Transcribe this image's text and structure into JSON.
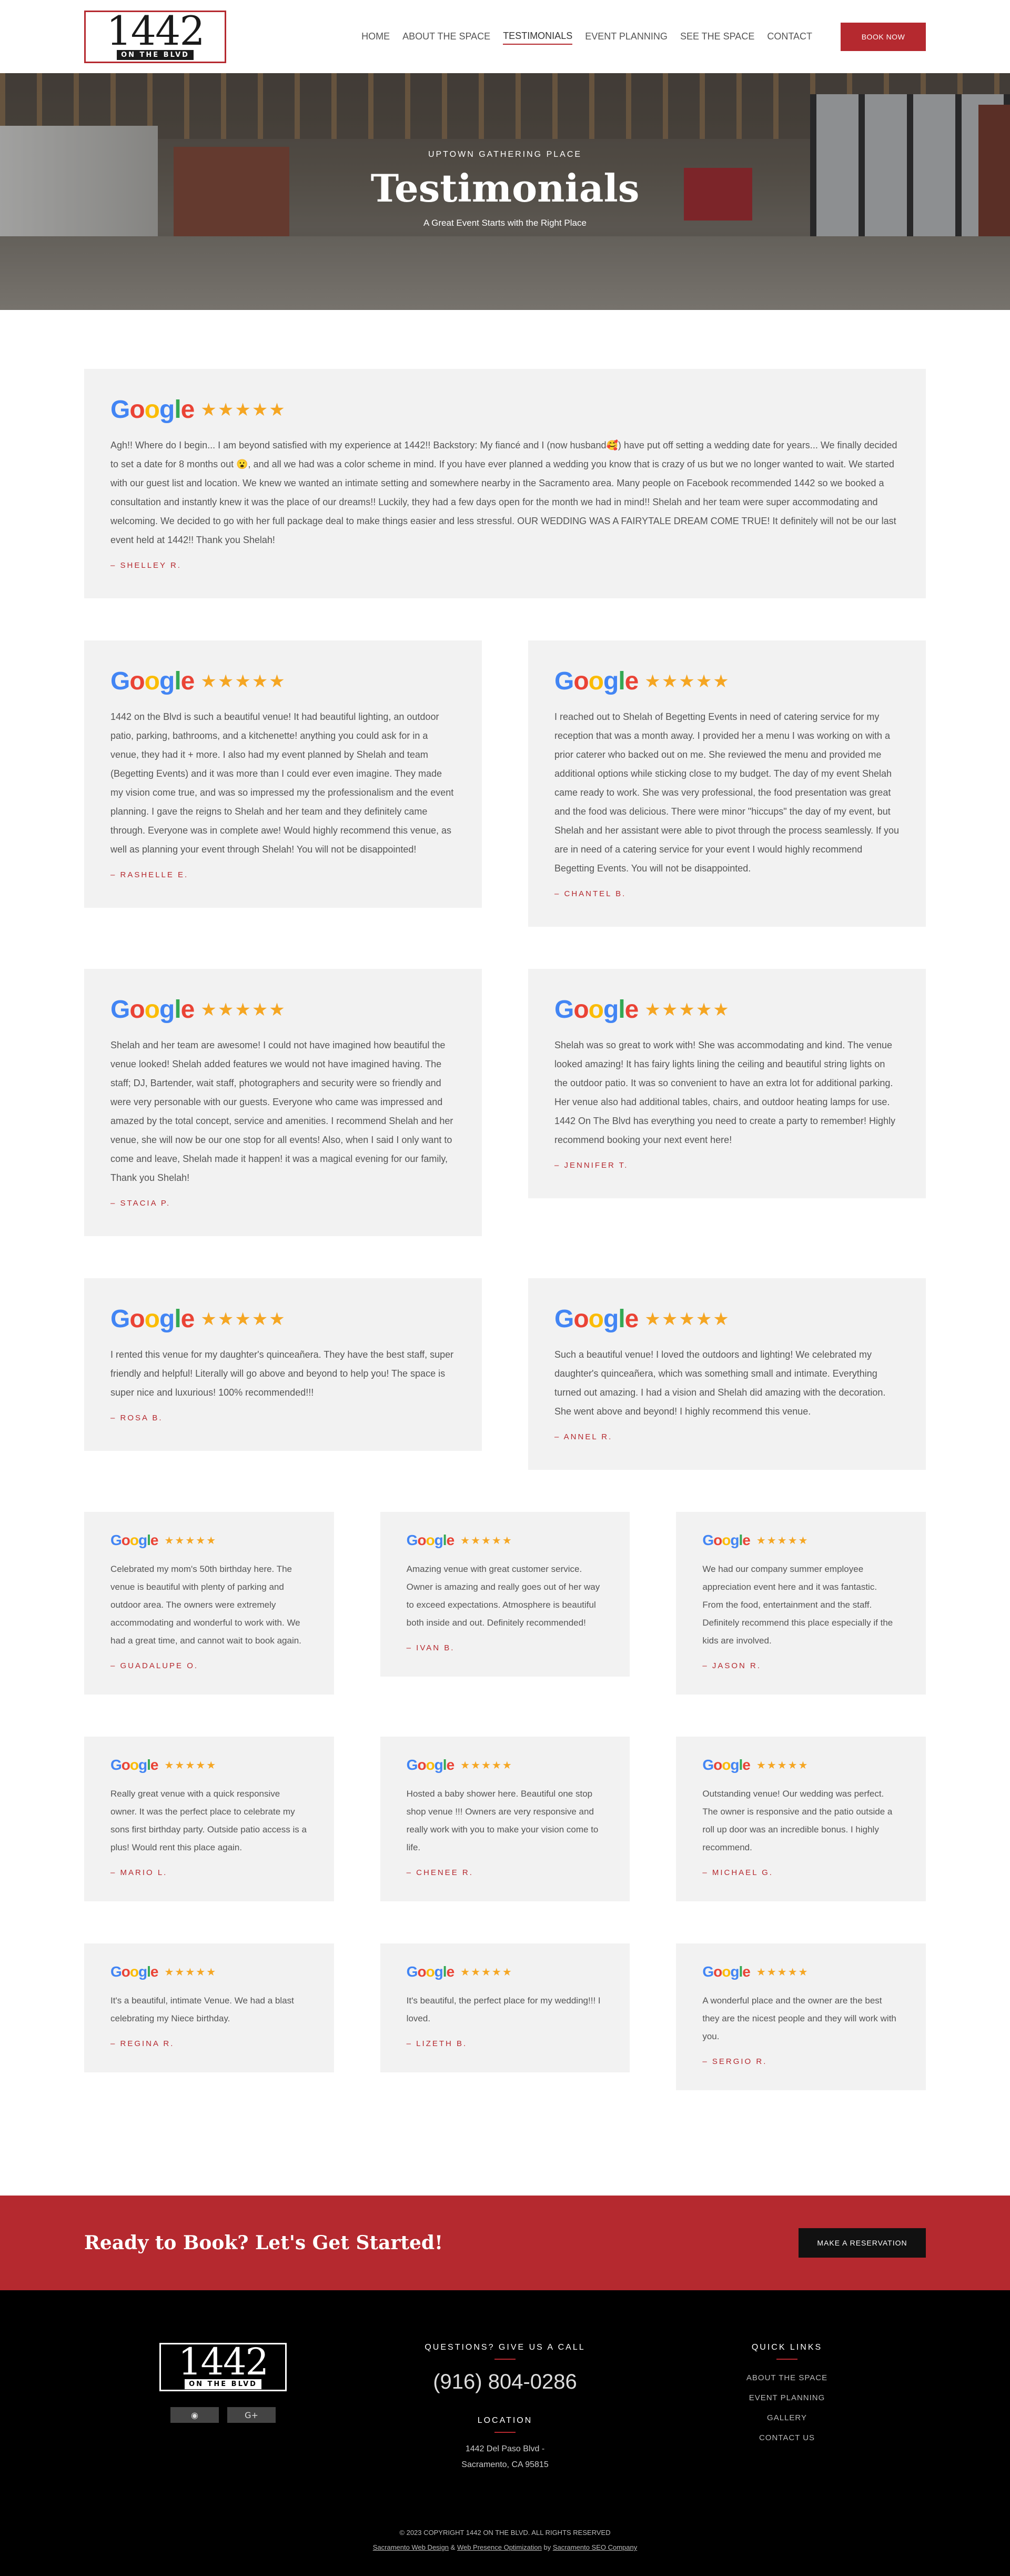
{
  "header": {
    "logo_number": "1442",
    "logo_sub": "ON THE BLVD",
    "nav": [
      {
        "label": "HOME",
        "active": false
      },
      {
        "label": "ABOUT THE SPACE",
        "active": false
      },
      {
        "label": "TESTIMONIALS",
        "active": true
      },
      {
        "label": "EVENT PLANNING",
        "active": false
      },
      {
        "label": "SEE THE SPACE",
        "active": false
      },
      {
        "label": "CONTACT",
        "active": false
      }
    ],
    "book_label": "BOOK NOW"
  },
  "hero": {
    "kicker": "UPTOWN GATHERING PLACE",
    "title": "Testimonials",
    "subtitle": "A Great Event Starts with the Right Place"
  },
  "google": {
    "word": "Google",
    "stars": "★★★★★"
  },
  "testimonials": [
    {
      "text": "Agh!! Where do I begin... I am beyond satisfied with my experience at 1442!! Backstory: My fiancé and I (now husband🥰) have put off setting a wedding date for years... We finally decided to set a date for 8 months out 😮, and all we had was a color scheme in mind. If you have ever planned a wedding you know that is crazy of us but we no longer wanted to wait. We started with our guest list and location. We knew we wanted an intimate setting and somewhere nearby in the Sacramento area. Many people on Facebook recommended 1442 so we booked a consultation and instantly knew it was the place of our dreams!! Luckily, they had a few days open for the month we had in mind!! Shelah and her team were super accommodating and welcoming. We decided to go with her full package deal to make things easier and less stressful. OUR WEDDING WAS A FAIRYTALE DREAM COME TRUE! It definitely will not be our last event held at 1442!! Thank you Shelah!",
      "author": "– SHELLEY R."
    },
    {
      "text": "1442 on the Blvd is such a beautiful venue! It had beautiful lighting, an outdoor patio, parking, bathrooms, and a kitchenette! anything you could ask for in a venue, they had it + more. I also had my event planned by Shelah and team (Begetting Events) and it was more than I could ever even imagine. They made my vision come true, and was so impressed my the professionalism and the event planning. I gave the reigns to Shelah and her team and they definitely came through. Everyone was in complete awe! Would highly recommend this venue, as well as planning your event through Shelah! You will not be disappointed!",
      "author": "– RASHELLE E."
    },
    {
      "text": "I reached out to Shelah of Begetting Events in need of catering service for my reception that was a month away. I provided her a menu I was working on with a prior caterer who backed out on me. She reviewed the menu and provided me additional options while sticking close to my budget. The day of my event Shelah came ready to work. She was very professional, the food presentation was great and the food was delicious. There were minor \"hiccups\" the day of my event, but Shelah and her assistant were able to pivot through the process seamlessly. If you are in need of a catering service for your event I would highly recommend Begetting Events. You will not be disappointed.",
      "author": "– CHANTEL B."
    },
    {
      "text": "Shelah and her team are awesome! I could not have imagined how beautiful the venue looked! Shelah added features we would not have imagined having. The staff; DJ, Bartender, wait staff, photographers and security were so friendly and were very personable with our guests. Everyone who came was impressed and amazed by the total concept, service and amenities. I recommend Shelah and her venue, she will now be our one stop for all events! Also, when I said I only want to come and leave, Shelah made it happen! it was a magical evening for our family, Thank you Shelah!",
      "author": "– STACIA P."
    },
    {
      "text": "Shelah was so great to work with! She was accommodating and kind. The venue looked amazing! It has fairy lights lining the ceiling and beautiful string lights on the outdoor patio. It was so convenient to have an extra lot for additional parking. Her venue also had additional tables, chairs, and outdoor heating lamps for use. 1442 On The Blvd has everything you need to create a party to remember! Highly recommend booking your next event here!",
      "author": "– JENNIFER T."
    },
    {
      "text": "I rented this venue for my daughter's quinceañera. They have the best staff, super friendly and helpful! Literally will go above and beyond to help you! The space is super nice and luxurious! 100% recommended!!!",
      "author": "– ROSA B."
    },
    {
      "text": "Such a beautiful venue! I loved the outdoors and lighting! We celebrated my daughter's quinceañera, which was something small and intimate. Everything turned out amazing. I had a vision and Shelah did amazing with the decoration. She went above and beyond! I highly recommend this venue.",
      "author": "– ANNEL R."
    },
    {
      "text": "Celebrated my mom's 50th birthday here. The venue is beautiful with plenty of parking and outdoor area. The owners were extremely accommodating and wonderful to work with. We had a great time, and cannot wait to book again.",
      "author": "– GUADALUPE O."
    },
    {
      "text": "Amazing venue with great customer service. Owner is amazing and really goes out of her way to exceed expectations. Atmosphere is beautiful both inside and out. Definitely recommended!",
      "author": "– IVAN B."
    },
    {
      "text": "We had our company summer employee appreciation event here and it was fantastic. From the food, entertainment and the staff. Definitely recommend this place especially if the kids are involved.",
      "author": "– JASON R."
    },
    {
      "text": "Really great venue with a quick responsive owner. It was the perfect place to celebrate my sons first birthday party. Outside patio access is a plus! Would rent this place again.",
      "author": "– MARIO L."
    },
    {
      "text": "Hosted a baby shower here. Beautiful one stop shop venue !!! Owners are very responsive and really work with you to make your vision come to life.",
      "author": "– CHENEE R."
    },
    {
      "text": "Outstanding venue! Our wedding was perfect. The owner is responsive and the patio outside a roll up door was an incredible bonus. I highly recommend.",
      "author": "– MICHAEL G."
    },
    {
      "text": "It's a beautiful, intimate Venue. We had a blast celebrating my Niece birthday.",
      "author": "– REGINA R."
    },
    {
      "text": "It's beautiful, the perfect place for my wedding!!! I loved.",
      "author": "– LIZETH B."
    },
    {
      "text": "A wonderful place and the owner are the best they are the nicest people and they will work with you.",
      "author": "– SERGIO R."
    }
  ],
  "cta": {
    "title_plain": "Ready to Book?",
    "title_bold": "Let's Get Started!",
    "button": "MAKE A RESERVATION"
  },
  "footer": {
    "logo_number": "1442",
    "logo_sub": "ON THE BLVD",
    "social": [
      "◉",
      "G+"
    ],
    "call_heading": "QUESTIONS? GIVE US A CALL",
    "phone": "(916) 804-0286",
    "location_heading": "LOCATION",
    "address_line1": "1442 Del Paso Blvd -",
    "address_line2": "Sacramento, CA 95815",
    "links_heading": "QUICK LINKS",
    "links": [
      "ABOUT THE SPACE",
      "EVENT PLANNING",
      "GALLERY",
      "CONTACT US"
    ],
    "copyright": "© 2023 COPYRIGHT 1442 ON THE BLVD. ALL RIGHTS RESERVED",
    "credit_1": "Sacramento Web Design",
    "credit_sep_1": "&",
    "credit_2": "Web Presence Optimization",
    "credit_by": "by",
    "credit_3": "Sacramento SEO Company"
  },
  "colors": {
    "brand_red": "#b5292f",
    "star_orange": "#f5a623",
    "card_bg": "#f2f2f2",
    "footer_bg": "#000000"
  }
}
